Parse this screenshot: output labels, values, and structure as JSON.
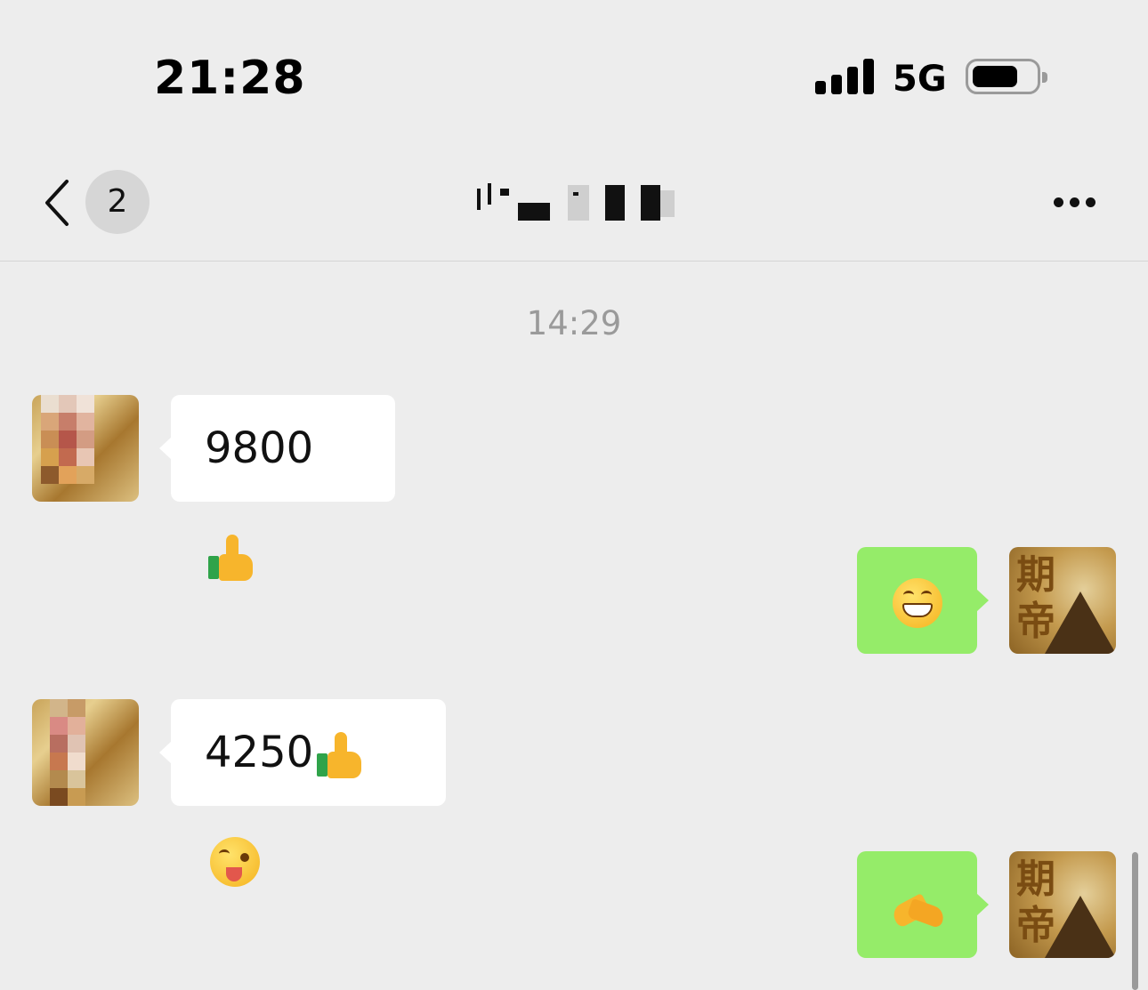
{
  "status_bar": {
    "time": "21:28",
    "network": "5G"
  },
  "nav": {
    "back_badge": "2",
    "title": ""
  },
  "chat": {
    "timestamp": "14:29",
    "messages": [
      {
        "from": "contact",
        "text": "9800",
        "emoji": [
          "thumbs-up"
        ]
      },
      {
        "from": "me",
        "text": "",
        "emoji": [
          "grinning-face"
        ]
      },
      {
        "from": "contact",
        "text": "4250",
        "emoji": [
          "thumbs-up",
          "winking-face-with-tongue"
        ]
      },
      {
        "from": "me",
        "text": "",
        "emoji": [
          "handshake-gesture"
        ]
      }
    ]
  },
  "self_avatar": {
    "chars": [
      "期",
      "帝"
    ]
  },
  "colors": {
    "background": "#ededed",
    "outgoing_bubble": "#95ec69",
    "incoming_bubble": "#ffffff"
  }
}
